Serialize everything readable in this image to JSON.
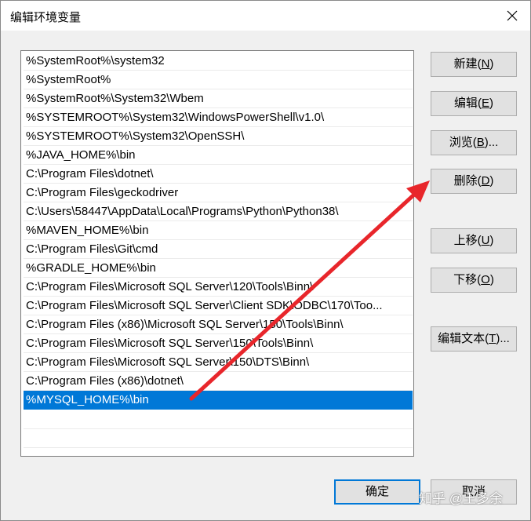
{
  "window": {
    "title": "编辑环境变量"
  },
  "path_list": {
    "items": [
      "%SystemRoot%\\system32",
      "%SystemRoot%",
      "%SystemRoot%\\System32\\Wbem",
      "%SYSTEMROOT%\\System32\\WindowsPowerShell\\v1.0\\",
      "%SYSTEMROOT%\\System32\\OpenSSH\\",
      "%JAVA_HOME%\\bin",
      "C:\\Program Files\\dotnet\\",
      "C:\\Program Files\\geckodriver",
      "C:\\Users\\58447\\AppData\\Local\\Programs\\Python\\Python38\\",
      "%MAVEN_HOME%\\bin",
      "C:\\Program Files\\Git\\cmd",
      "%GRADLE_HOME%\\bin",
      "C:\\Program Files\\Microsoft SQL Server\\120\\Tools\\Binn\\",
      "C:\\Program Files\\Microsoft SQL Server\\Client SDK\\ODBC\\170\\Too...",
      "C:\\Program Files (x86)\\Microsoft SQL Server\\150\\Tools\\Binn\\",
      "C:\\Program Files\\Microsoft SQL Server\\150\\Tools\\Binn\\",
      "C:\\Program Files\\Microsoft SQL Server\\150\\DTS\\Binn\\",
      "C:\\Program Files (x86)\\dotnet\\",
      "%MYSQL_HOME%\\bin"
    ],
    "selected_index": 18
  },
  "buttons": {
    "new": {
      "label": "新建(",
      "key": "N",
      "tail": ")"
    },
    "edit": {
      "label": "编辑(",
      "key": "E",
      "tail": ")"
    },
    "browse": {
      "label": "浏览(",
      "key": "B",
      "tail": ")..."
    },
    "delete": {
      "label": "删除(",
      "key": "D",
      "tail": ")"
    },
    "move_up": {
      "label": "上移(",
      "key": "U",
      "tail": ")"
    },
    "move_down": {
      "label": "下移(",
      "key": "O",
      "tail": ")"
    },
    "edit_text": {
      "label": "编辑文本(",
      "key": "T",
      "tail": ")..."
    },
    "ok": {
      "label": "确定"
    },
    "cancel": {
      "label": "取消"
    }
  },
  "watermark": {
    "text": "知乎 @王多余"
  },
  "annotation": {
    "color": "#e8262b"
  }
}
